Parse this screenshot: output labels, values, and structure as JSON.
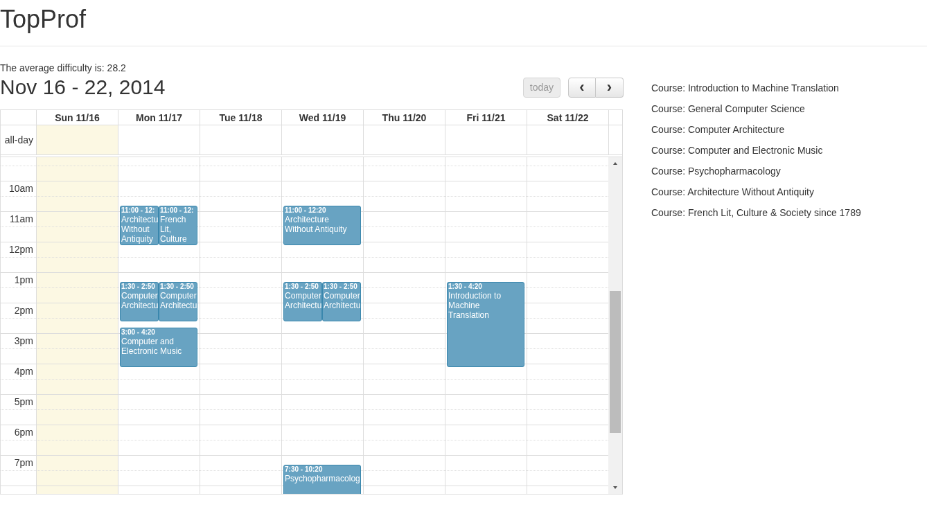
{
  "app_title": "TopProf",
  "average": "The average difficulty is: 28.2",
  "range_title": "Nov 16 - 22, 2014",
  "buttons": {
    "today": {
      "label": "today",
      "disabled": true
    },
    "prev": "‹",
    "next": "›"
  },
  "all_day_label": "all-day",
  "hours": [
    "10am",
    "11am",
    "12pm",
    "1pm",
    "2pm",
    "3pm",
    "4pm",
    "5pm",
    "6pm",
    "7pm"
  ],
  "days": [
    {
      "label": "Sun 11/16",
      "today": true
    },
    {
      "label": "Mon 11/17",
      "today": false,
      "events": [
        {
          "time": "11:00 - 12:",
          "lines": [
            "Architectu",
            "Without",
            "Antiquity"
          ]
        },
        {
          "time": "11:00 - 12:",
          "lines": [
            "French",
            "Lit,",
            "Culture"
          ]
        },
        {
          "time": "1:30 - 2:50",
          "lines": [
            "Computer",
            "Architectu"
          ]
        },
        {
          "time": "1:30 - 2:50",
          "lines": [
            "Computer",
            "Architectu"
          ]
        },
        {
          "time": "3:00 - 4:20",
          "lines": [
            "Computer and",
            "Electronic Music"
          ]
        }
      ]
    },
    {
      "label": "Tue 11/18",
      "today": false
    },
    {
      "label": "Wed 11/19",
      "today": false,
      "events": [
        {
          "time": "11:00 - 12:20",
          "lines": [
            "Architecture",
            "Without Antiquity"
          ]
        },
        {
          "time": "1:30 - 2:50",
          "lines": [
            "Computer",
            "Architectu"
          ]
        },
        {
          "time": "1:30 - 2:50",
          "lines": [
            "Computer",
            "Architectu"
          ]
        },
        {
          "time": "7:30 - 10:20",
          "lines": [
            "Psychopharmacolog"
          ]
        }
      ]
    },
    {
      "label": "Thu 11/20",
      "today": false
    },
    {
      "label": "Fri 11/21",
      "today": false,
      "events": [
        {
          "time": "1:30 - 4:20",
          "lines": [
            "Introduction to",
            "Machine",
            "Translation"
          ]
        }
      ]
    },
    {
      "label": "Sat 11/22",
      "today": false
    }
  ],
  "courses": [
    "Course: Introduction to Machine Translation",
    "Course: General Computer Science",
    "Course: Computer Architecture",
    "Course: Computer and Electronic Music",
    "Course: Psychopharmacology",
    "Course: Architecture Without Antiquity",
    "Course: French Lit, Culture & Society since 1789"
  ]
}
